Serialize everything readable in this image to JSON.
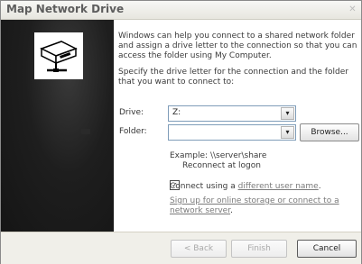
{
  "window": {
    "title": "Map Network Drive",
    "close_glyph": "✕"
  },
  "description": {
    "para1": "Windows can help you connect to a shared network folder and assign a drive letter to the connection so that you can access the folder using My Computer.",
    "para2": "Specify the drive letter for the connection and the folder that you want to connect to:"
  },
  "drive": {
    "label": "Drive:",
    "value": "Z:"
  },
  "folder": {
    "label": "Folder:",
    "value": ""
  },
  "browse_label": "Browse...",
  "example_text": "Example: \\\\server\\share",
  "reconnect": {
    "label": "Reconnect at logon",
    "checked": true,
    "mark": "✓"
  },
  "connect_using": {
    "prefix": "Connect using a ",
    "link": "different user name",
    "suffix": "."
  },
  "signup_link": {
    "text": "Sign up for online storage or connect to a network server",
    "suffix": "."
  },
  "buttons": {
    "back": "< Back",
    "finish": "Finish",
    "cancel": "Cancel"
  },
  "icons": {
    "dropdown": "▾",
    "network_drive": "network-drive-icon"
  }
}
